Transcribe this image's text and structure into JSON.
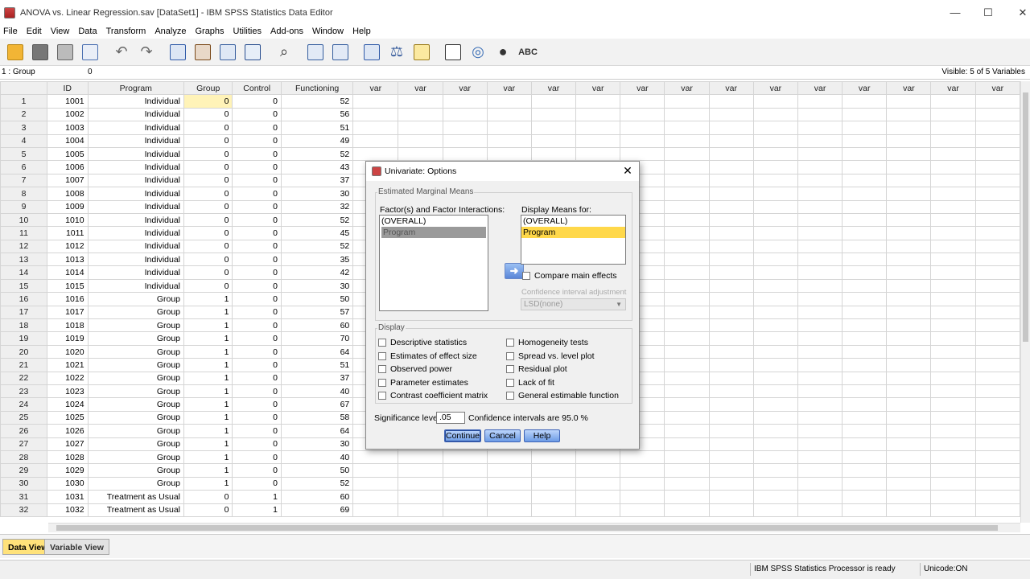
{
  "window": {
    "title": "ANOVA vs. Linear Regression.sav [DataSet1] - IBM SPSS Statistics Data Editor",
    "min": "—",
    "max": "☐",
    "close": "✕"
  },
  "menu": [
    "File",
    "Edit",
    "View",
    "Data",
    "Transform",
    "Analyze",
    "Graphs",
    "Utilities",
    "Add-ons",
    "Window",
    "Help"
  ],
  "toolbar": [
    "open-folder",
    "save",
    "print",
    "recall-dialog",
    "undo",
    "redo",
    "goto-case",
    "goto-variable",
    "variables",
    "run-descriptives",
    "find",
    "insert-cases",
    "insert-variable",
    "split-file",
    "weight-cases",
    "select-cases",
    "value-labels",
    "use-sets",
    "show-all",
    "spelling"
  ],
  "cellbar": {
    "ref": "1 : Group",
    "value": "0",
    "visible": "Visible: 5 of 5 Variables"
  },
  "columns": [
    "ID",
    "Program",
    "Group",
    "Control",
    "Functioning",
    "var",
    "var",
    "var",
    "var",
    "var",
    "var",
    "var",
    "var",
    "var",
    "var",
    "var",
    "var",
    "var",
    "var",
    "var"
  ],
  "rows": [
    [
      "1",
      "1001",
      "Individual",
      "0",
      "0",
      "52"
    ],
    [
      "2",
      "1002",
      "Individual",
      "0",
      "0",
      "56"
    ],
    [
      "3",
      "1003",
      "Individual",
      "0",
      "0",
      "51"
    ],
    [
      "4",
      "1004",
      "Individual",
      "0",
      "0",
      "49"
    ],
    [
      "5",
      "1005",
      "Individual",
      "0",
      "0",
      "52"
    ],
    [
      "6",
      "1006",
      "Individual",
      "0",
      "0",
      "43"
    ],
    [
      "7",
      "1007",
      "Individual",
      "0",
      "0",
      "37"
    ],
    [
      "8",
      "1008",
      "Individual",
      "0",
      "0",
      "30"
    ],
    [
      "9",
      "1009",
      "Individual",
      "0",
      "0",
      "32"
    ],
    [
      "10",
      "1010",
      "Individual",
      "0",
      "0",
      "52"
    ],
    [
      "11",
      "1011",
      "Individual",
      "0",
      "0",
      "45"
    ],
    [
      "12",
      "1012",
      "Individual",
      "0",
      "0",
      "52"
    ],
    [
      "13",
      "1013",
      "Individual",
      "0",
      "0",
      "35"
    ],
    [
      "14",
      "1014",
      "Individual",
      "0",
      "0",
      "42"
    ],
    [
      "15",
      "1015",
      "Individual",
      "0",
      "0",
      "30"
    ],
    [
      "16",
      "1016",
      "Group",
      "1",
      "0",
      "50"
    ],
    [
      "17",
      "1017",
      "Group",
      "1",
      "0",
      "57"
    ],
    [
      "18",
      "1018",
      "Group",
      "1",
      "0",
      "60"
    ],
    [
      "19",
      "1019",
      "Group",
      "1",
      "0",
      "70"
    ],
    [
      "20",
      "1020",
      "Group",
      "1",
      "0",
      "64"
    ],
    [
      "21",
      "1021",
      "Group",
      "1",
      "0",
      "51"
    ],
    [
      "22",
      "1022",
      "Group",
      "1",
      "0",
      "37"
    ],
    [
      "23",
      "1023",
      "Group",
      "1",
      "0",
      "40"
    ],
    [
      "24",
      "1024",
      "Group",
      "1",
      "0",
      "67"
    ],
    [
      "25",
      "1025",
      "Group",
      "1",
      "0",
      "58"
    ],
    [
      "26",
      "1026",
      "Group",
      "1",
      "0",
      "64"
    ],
    [
      "27",
      "1027",
      "Group",
      "1",
      "0",
      "30"
    ],
    [
      "28",
      "1028",
      "Group",
      "1",
      "0",
      "40"
    ],
    [
      "29",
      "1029",
      "Group",
      "1",
      "0",
      "50"
    ],
    [
      "30",
      "1030",
      "Group",
      "1",
      "0",
      "52"
    ],
    [
      "31",
      "1031",
      "Treatment as Usual",
      "0",
      "1",
      "60"
    ],
    [
      "32",
      "1032",
      "Treatment as Usual",
      "0",
      "1",
      "69"
    ]
  ],
  "tabs": {
    "data_view": "Data View",
    "variable_view": "Variable View"
  },
  "status": {
    "processor": "IBM SPSS Statistics Processor is ready",
    "unicode": "Unicode:ON"
  },
  "dialog": {
    "title": "Univariate: Options",
    "close": "✕",
    "emm_legend": "Estimated Marginal Means",
    "factors_label": "Factor(s) and Factor Interactions:",
    "factors": [
      "(OVERALL)",
      "Program"
    ],
    "move_arrow": "➜",
    "display_means_label": "Display Means for:",
    "display_means": [
      "(OVERALL)",
      "Program"
    ],
    "compare_main_effects": "Compare main effects",
    "ci_adjustment_label": "Confidence interval adjustment",
    "ci_adjustment_value": "LSD(none)",
    "display_legend": "Display",
    "display_left": [
      "Descriptive statistics",
      "Estimates of effect size",
      "Observed power",
      "Parameter estimates",
      "Contrast coefficient matrix"
    ],
    "display_right": [
      "Homogeneity tests",
      "Spread vs. level plot",
      "Residual plot",
      "Lack of fit",
      "General estimable function"
    ],
    "sig_label": "Significance level:",
    "sig_value": ".05",
    "ci_text": "Confidence intervals are 95.0 %",
    "continue": "Continue",
    "cancel": "Cancel",
    "help": "Help"
  }
}
